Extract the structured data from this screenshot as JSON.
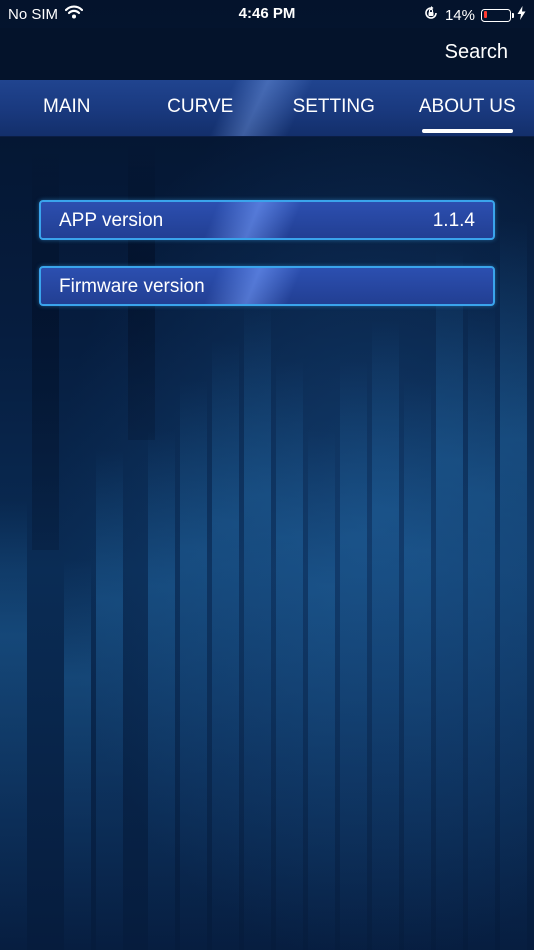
{
  "status_bar": {
    "carrier": "No SIM",
    "time": "4:46 PM",
    "battery_percent": "14%",
    "battery_level": 0.14,
    "battery_color": "#ff3b30"
  },
  "header": {
    "search_label": "Search"
  },
  "tabs": [
    {
      "label": "MAIN",
      "active": false
    },
    {
      "label": "CURVE",
      "active": false
    },
    {
      "label": "SETTING",
      "active": false
    },
    {
      "label": "ABOUT US",
      "active": true
    }
  ],
  "about": {
    "app_version_label": "APP version",
    "app_version_value": "1.1.4",
    "firmware_version_label": "Firmware version",
    "firmware_version_value": ""
  },
  "colors": {
    "accent_border": "#3aa4ec",
    "tabbar": "#1a3a80",
    "header_bg": "#04132b"
  }
}
